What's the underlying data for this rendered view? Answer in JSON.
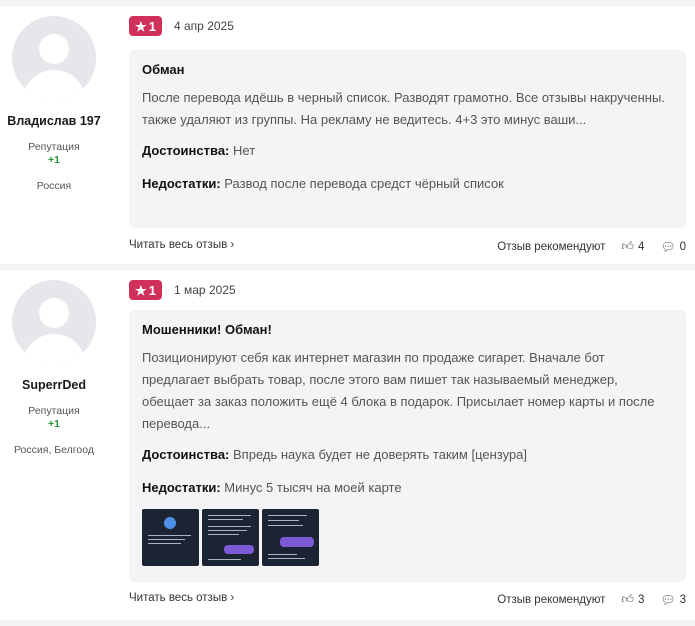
{
  "reviews": [
    {
      "author": "Владислав 197",
      "reputation_label": "Репутация",
      "reputation_value": "+1",
      "location": "Россия",
      "rating": "1",
      "date": "4 апр 2025",
      "title": "Обман",
      "text": "После перевода идёшь в черный список. Разводят грамотно. Все отзывы накрученны. также удаляют из группы. На рекламу не ведитесь. 4+3 это минус ваши...",
      "pros_label": "Достоинства:",
      "pros": "Нет",
      "cons_label": "Недостатки:",
      "cons": "Развод после перевода средст чёрный список",
      "read_more": "Читать весь отзыв",
      "recommend_label": "Отзыв рекомендуют",
      "likes": "4",
      "comments": "0"
    },
    {
      "author": "SuperrDed",
      "reputation_label": "Репутация",
      "reputation_value": "+1",
      "location": "Россия, Белгоод",
      "rating": "1",
      "date": "1 мар 2025",
      "title": "Мошенники! Обман!",
      "text": "Позиционируют себя как интернет магазин по продаже сигарет. Вначале бот предлагает выбрать товар, после этого вам пишет так называемый менеджер, обещает за заказ положить ещё 4 блока в подарок. Присылает номер карты и после перевода...",
      "pros_label": "Достоинства:",
      "pros": "Впредь наука будет не доверять таким [цензура]",
      "cons_label": "Недостатки:",
      "cons": "Минус 5 тысяч на моей карте",
      "read_more": "Читать весь отзыв",
      "recommend_label": "Отзыв рекомендуют",
      "likes": "3",
      "comments": "3"
    }
  ],
  "icons": {
    "star": "star-icon",
    "chevron": "chevron-right-icon",
    "like": "thumbs-up-icon",
    "comment": "comment-icon"
  },
  "colors": {
    "rating_badge": "#d0315a",
    "reputation_positive": "#2a9a3a",
    "card_background": "#f4f4f6"
  }
}
